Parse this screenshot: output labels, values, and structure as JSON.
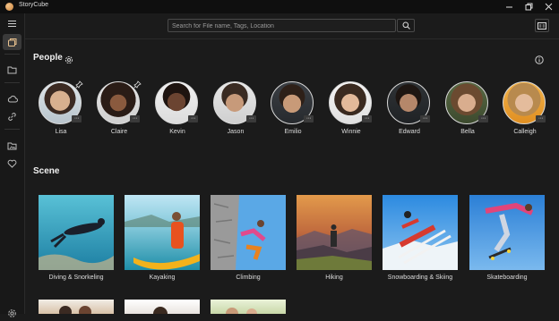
{
  "app": {
    "title": "StoryCube"
  },
  "search": {
    "placeholder": "Search for File name, Tags, Location"
  },
  "people": {
    "title": "People",
    "items": [
      {
        "name": "Lisa",
        "pinned": true
      },
      {
        "name": "Claire",
        "pinned": true
      },
      {
        "name": "Kevin",
        "pinned": false
      },
      {
        "name": "Jason",
        "pinned": false
      },
      {
        "name": "Emilio",
        "pinned": false
      },
      {
        "name": "Winnie",
        "pinned": false
      },
      {
        "name": "Edward",
        "pinned": false
      },
      {
        "name": "Bella",
        "pinned": false
      },
      {
        "name": "Calleigh",
        "pinned": false
      }
    ]
  },
  "scene": {
    "title": "Scene",
    "items": [
      {
        "name": "Diving & Snorkeling"
      },
      {
        "name": "Kayaking"
      },
      {
        "name": "Climbing"
      },
      {
        "name": "Hiking"
      },
      {
        "name": "Snowboarding & Skiing"
      },
      {
        "name": "Skateboarding"
      }
    ]
  },
  "icons": {
    "menu": "hamburger-menu-icon",
    "photos": "photos-icon",
    "folder": "folder-icon",
    "cloud": "cloud-icon",
    "link": "link-icon",
    "folder_image": "folder-image-icon",
    "heart": "heart-icon",
    "settings": "gear-icon",
    "info": "info-icon",
    "pin": "pin-icon",
    "search": "search-icon",
    "view": "view-toggle-icon"
  },
  "colors": {
    "accent": "#c8a57a",
    "background": "#1b1b1b"
  }
}
